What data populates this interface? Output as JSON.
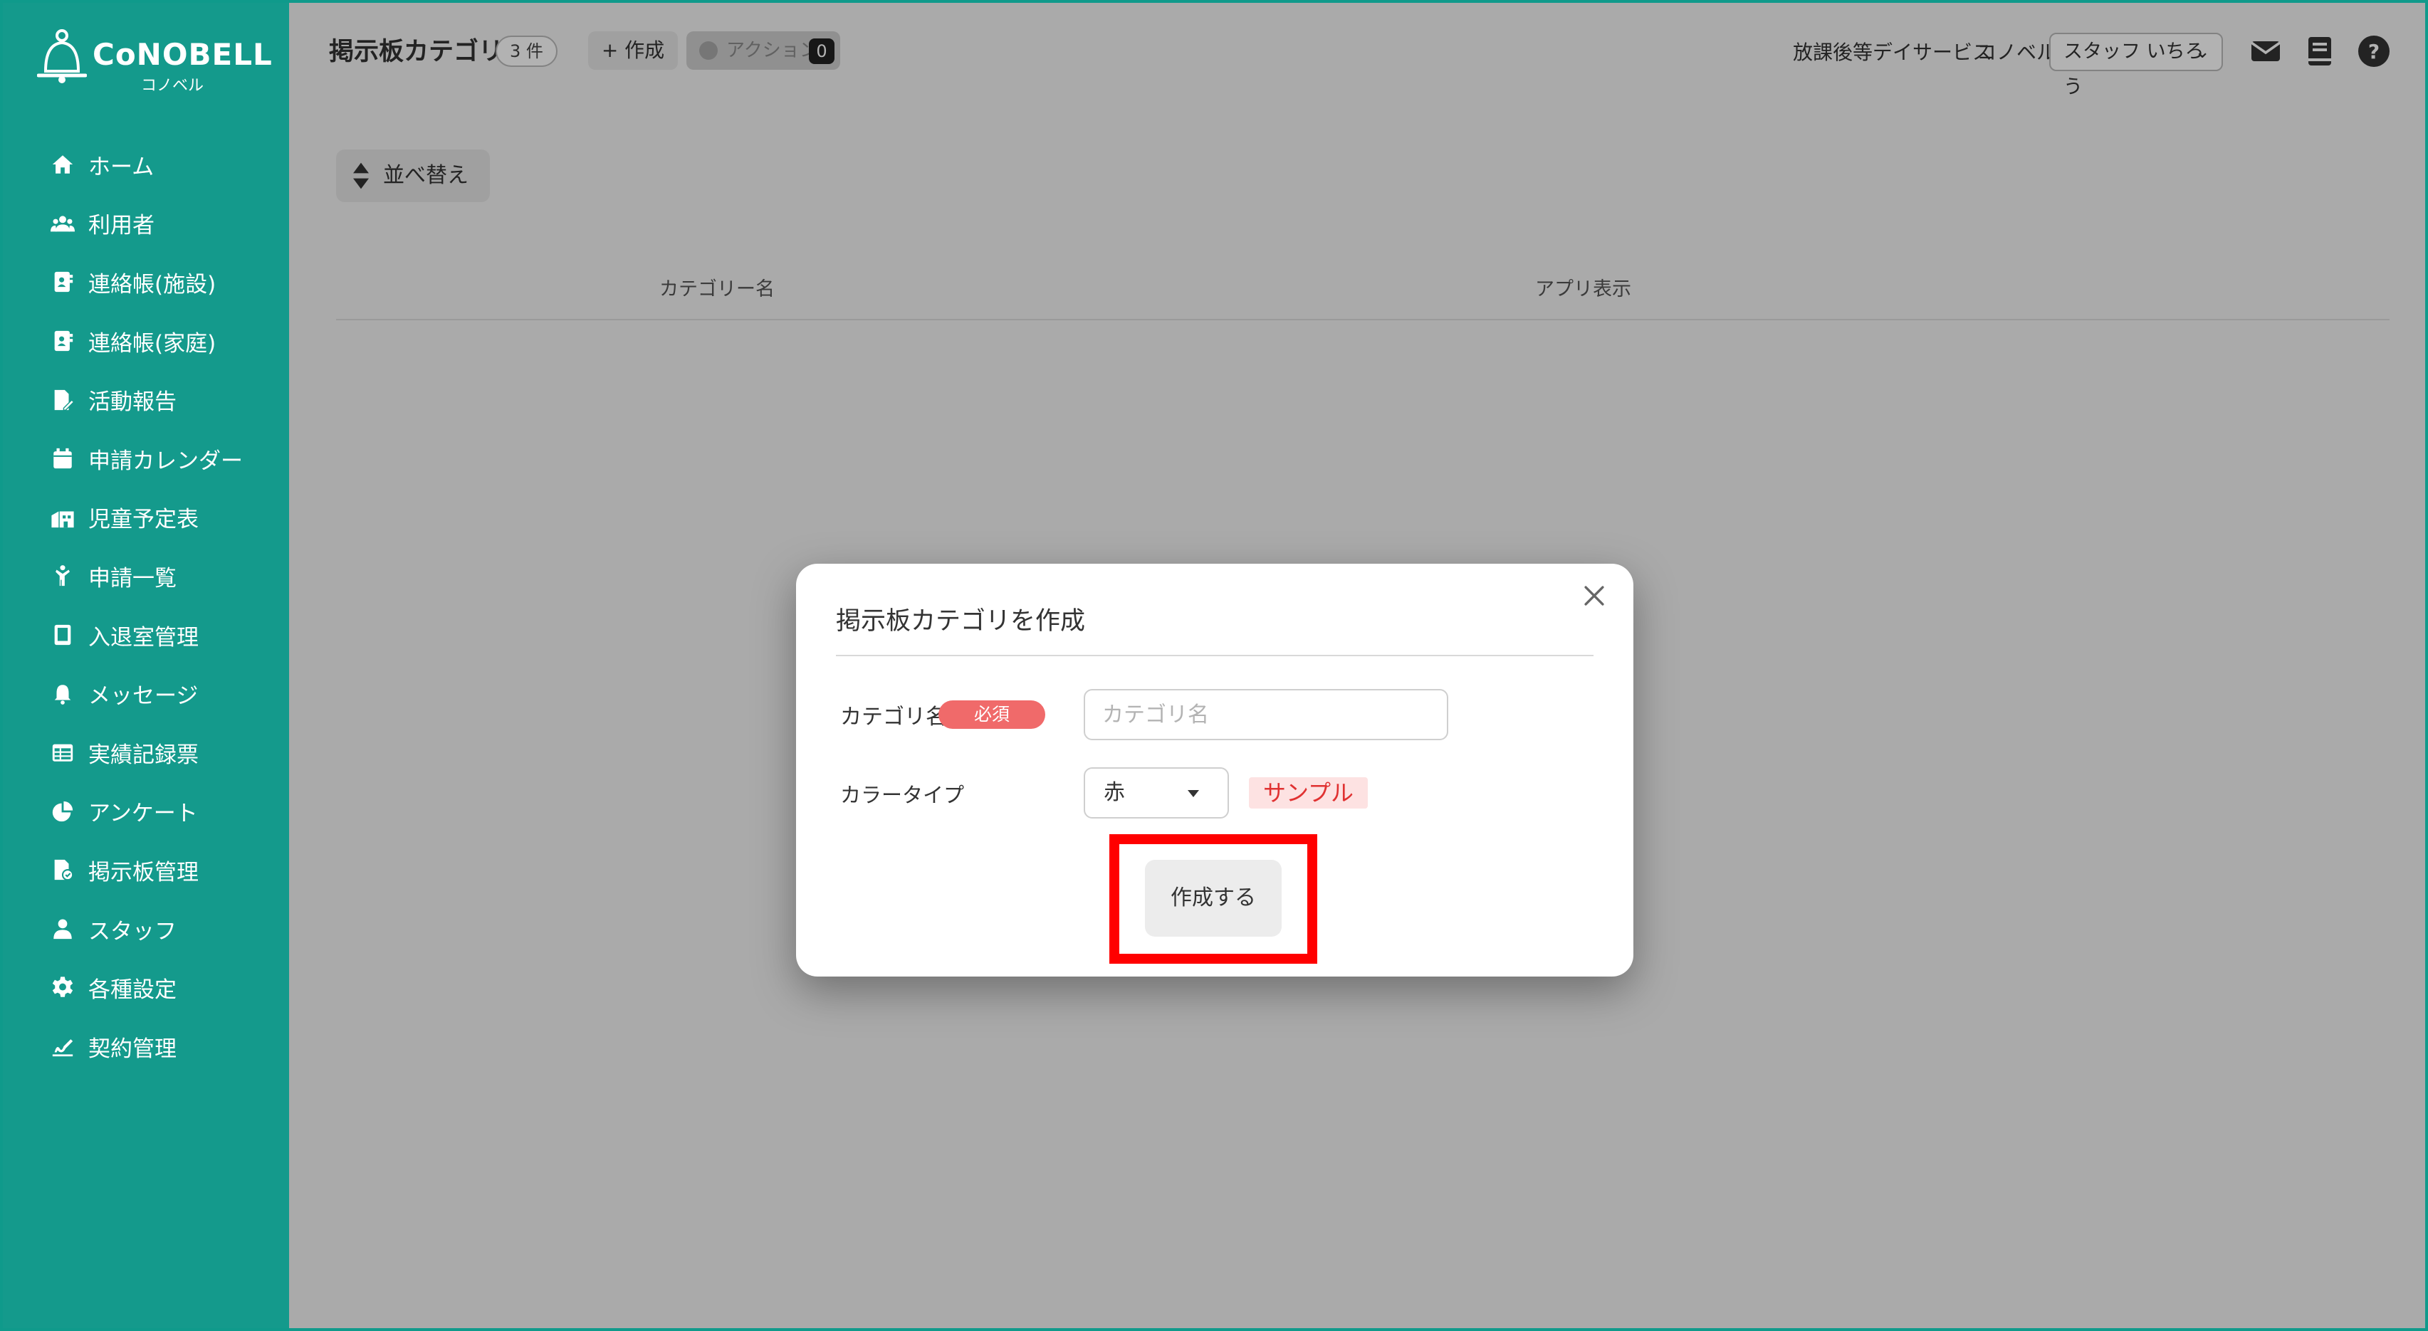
{
  "brand": {
    "name": "CoNOBELL",
    "kana": "コノベル",
    "color": "#149a8c"
  },
  "sidebar": {
    "items": [
      {
        "label": "ホーム",
        "icon": "home-icon"
      },
      {
        "label": "利用者",
        "icon": "users-icon"
      },
      {
        "label": "連絡帳(施設)",
        "icon": "contact-book-icon"
      },
      {
        "label": "連絡帳(家庭)",
        "icon": "contact-book-icon"
      },
      {
        "label": "活動報告",
        "icon": "report-edit-icon"
      },
      {
        "label": "申請カレンダー",
        "icon": "calendar-icon"
      },
      {
        "label": "児童予定表",
        "icon": "schedule-icon"
      },
      {
        "label": "申請一覧",
        "icon": "person-icon"
      },
      {
        "label": "入退室管理",
        "icon": "tablet-icon"
      },
      {
        "label": "メッセージ",
        "icon": "bell-icon"
      },
      {
        "label": "実績記録票",
        "icon": "table-icon"
      },
      {
        "label": "アンケート",
        "icon": "pie-chart-icon"
      },
      {
        "label": "掲示板管理",
        "icon": "board-icon"
      },
      {
        "label": "スタッフ",
        "icon": "staff-icon"
      },
      {
        "label": "各種設定",
        "icon": "gear-icon"
      },
      {
        "label": "契約管理",
        "icon": "contract-icon"
      }
    ]
  },
  "header": {
    "title": "掲示板カテゴリ",
    "count": "3 件",
    "create_label": "+ 作成",
    "action_label": "アクション",
    "action_count": "0",
    "facility": "放課後等デイサービス",
    "company": "コノベル",
    "staff_select": "スタッフ いちろう"
  },
  "toolbar": {
    "sort_label": "並べ替え"
  },
  "table": {
    "columns": [
      "カテゴリー名",
      "アプリ表示"
    ]
  },
  "modal": {
    "title": "掲示板カテゴリを作成",
    "category_label": "カテゴリ名",
    "required_badge": "必須",
    "category_placeholder": "カテゴリ名",
    "category_value": "",
    "color_label": "カラータイプ",
    "color_value": "赤",
    "sample_label": "サンプル",
    "submit_label": "作成する"
  },
  "colors": {
    "required": "#f06a6a",
    "sample_text": "#e03131",
    "sample_bg": "#fde2e2",
    "highlight": "#ff0000"
  }
}
